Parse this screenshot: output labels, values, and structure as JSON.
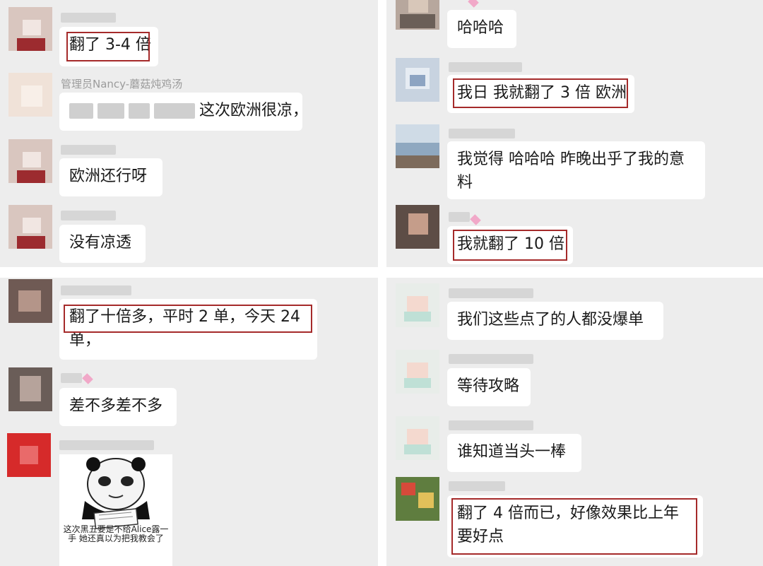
{
  "panels": {
    "top_left": {
      "messages": [
        {
          "text": "翻了 3-4 倍"
        },
        {
          "sender": "管理员Nancy-蘑菇炖鸡汤",
          "text": "这次欧洲很凉，"
        },
        {
          "text": "欧洲还行呀"
        },
        {
          "text": "没有凉透"
        }
      ]
    },
    "top_right": {
      "messages": [
        {
          "text": "哈哈哈"
        },
        {
          "text": "我日 我就翻了 3 倍 欧洲"
        },
        {
          "text": "我觉得 哈哈哈 昨晚出乎了我的意料"
        },
        {
          "text": "我就翻了 10 倍"
        }
      ]
    },
    "bottom_left": {
      "messages": [
        {
          "text": "翻了十倍多，平时 2 单，今天 24 单，"
        },
        {
          "text": "差不多差不多"
        },
        {
          "sticker_caption": "这次黑五要是不给Alice露一手 她还真以为把我教会了"
        }
      ]
    },
    "bottom_right": {
      "messages": [
        {
          "text": "我们这些点了的人都没爆单"
        },
        {
          "text": "等待攻略"
        },
        {
          "text": "谁知道当头一棒"
        },
        {
          "text": "翻了 4 倍而已，好像效果比上年要好点"
        }
      ]
    }
  },
  "colors": {
    "chat_background": "#ededed",
    "bubble": "#ffffff",
    "highlight_box": "#a52a2a"
  }
}
